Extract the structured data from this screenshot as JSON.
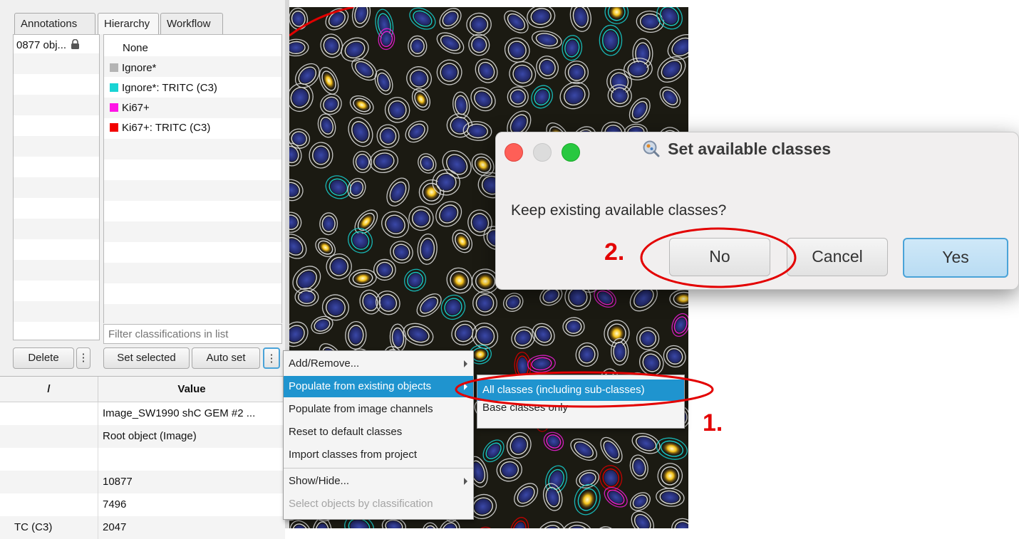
{
  "tabs": [
    "Annotations",
    "Hierarchy",
    "Workflow"
  ],
  "annotation_item": "0877 obj...",
  "classes": [
    {
      "label": "None",
      "color": ""
    },
    {
      "label": "Ignore*",
      "color": "#b4b4b4"
    },
    {
      "label": "Ignore*: TRITC (C3)",
      "color": "#19d4d4"
    },
    {
      "label": "Ki67+",
      "color": "#ff14e6"
    },
    {
      "label": "Ki67+: TRITC (C3)",
      "color": "#f20000"
    }
  ],
  "filter_placeholder": "Filter classifications in list",
  "buttons": {
    "delete": "Delete",
    "more": "⋮",
    "set_selected": "Set selected",
    "auto_set": "Auto set"
  },
  "table": {
    "header_left": "/",
    "header_value": "Value",
    "rows": [
      {
        "key": "",
        "value": "Image_SW1990 shC GEM #2 ..."
      },
      {
        "key": "",
        "value": "Root object (Image)"
      },
      {
        "key": "",
        "value": ""
      },
      {
        "key": "",
        "value": "10877"
      },
      {
        "key": "",
        "value": "7496"
      },
      {
        "key": "TC (C3)",
        "value": "2047"
      }
    ]
  },
  "context_menu": {
    "items": [
      {
        "label": "Add/Remove...",
        "submenu": true,
        "selected": false,
        "disabled": false
      },
      {
        "label": "Populate from existing objects",
        "submenu": true,
        "selected": true,
        "disabled": false
      },
      {
        "label": "Populate from image channels",
        "submenu": false,
        "selected": false,
        "disabled": false
      },
      {
        "label": "Reset to default classes",
        "submenu": false,
        "selected": false,
        "disabled": false
      },
      {
        "label": "Import classes from project",
        "submenu": false,
        "selected": false,
        "disabled": false
      },
      {
        "label": "Show/Hide...",
        "submenu": true,
        "selected": false,
        "disabled": false
      },
      {
        "label": "Select objects by classification",
        "submenu": false,
        "selected": false,
        "disabled": true
      }
    ],
    "submenu": [
      "All classes (including sub-classes)",
      "Base classes only"
    ]
  },
  "dialog": {
    "title": "Set available classes",
    "message": "Keep existing available classes?",
    "buttons": {
      "no": "No",
      "cancel": "Cancel",
      "yes": "Yes"
    }
  },
  "annotations": {
    "step1": "1.",
    "step2": "2."
  },
  "colors": {
    "highlight": "#1f94cf",
    "annotation_red": "#e30000",
    "default_button": "#4aa3d8"
  },
  "icons": {
    "lock": "lock-icon",
    "app": "qupath-icon",
    "submenu": "chevron-right-icon"
  }
}
